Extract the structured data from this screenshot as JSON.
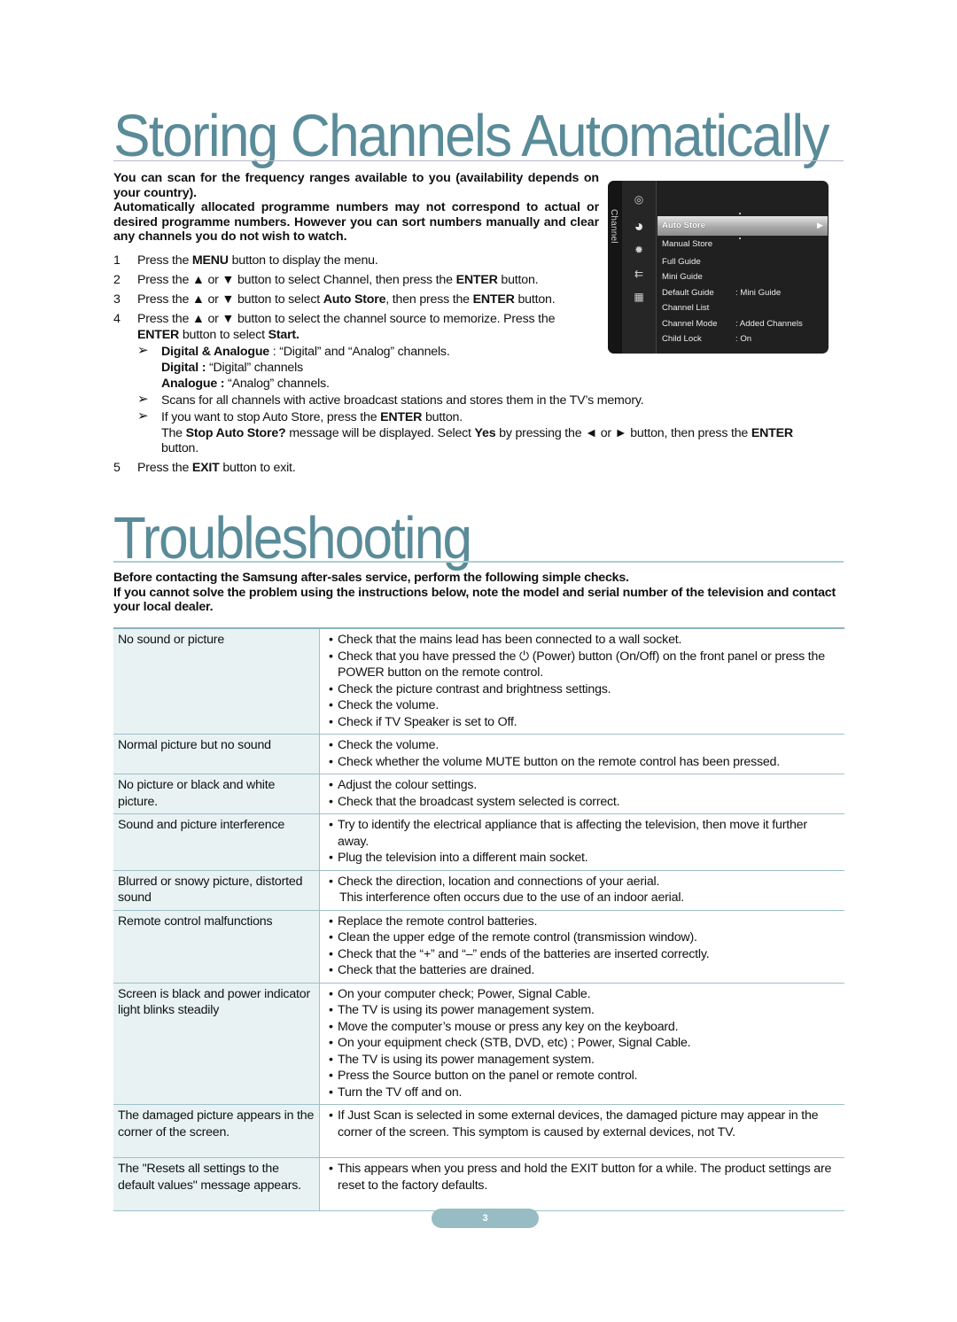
{
  "section1": {
    "title": "Storing Channels Automatically",
    "intro": [
      "You can scan for the frequency ranges available to you (availability depends on your country).",
      "Automatically allocated programme numbers may not correspond to actual or desired programme numbers. However you can sort numbers manually and clear any channels you do not wish to watch."
    ],
    "steps": [
      {
        "num": "1",
        "parts": [
          [
            "Press the ",
            false
          ],
          [
            "MENU",
            true
          ],
          [
            " button to display the menu.",
            false
          ]
        ]
      },
      {
        "num": "2",
        "parts": [
          [
            "Press the ▲ or ▼ button to select Channel, then press the ",
            false
          ],
          [
            "ENTER",
            true
          ],
          [
            " button.",
            false
          ]
        ]
      },
      {
        "num": "3",
        "parts": [
          [
            "Press the ▲ or ▼ button to select ",
            false
          ],
          [
            "Auto Store",
            true
          ],
          [
            ", then press  the ",
            false
          ],
          [
            "ENTER",
            true
          ],
          [
            " button.",
            false
          ]
        ]
      },
      {
        "num": "4",
        "parts": [
          [
            "Press the ▲ or ▼ button to select the channel source to memorize. Press the ",
            false
          ],
          [
            "ENTER",
            true
          ],
          [
            " button to select ",
            false
          ],
          [
            "Start.",
            true
          ]
        ]
      }
    ],
    "notes": [
      {
        "lines": [
          [
            [
              "Digital & Analogue",
              true
            ],
            [
              " : “Digital” and “Analog” channels.",
              false
            ]
          ],
          [
            [
              "Digital :",
              true
            ],
            [
              " “Digital” channels",
              false
            ]
          ],
          [
            [
              "Analogue :",
              true
            ],
            [
              " “Analog” channels.",
              false
            ]
          ]
        ]
      },
      {
        "lines": [
          [
            [
              "Scans for all channels with active broadcast stations and stores them in the TV’s memory.",
              false
            ]
          ]
        ]
      },
      {
        "lines": [
          [
            [
              "If you want to stop Auto Store, press the ",
              false
            ],
            [
              "ENTER",
              true
            ],
            [
              " button.",
              false
            ]
          ]
        ]
      }
    ],
    "stop_message": [
      [
        "The ",
        false
      ],
      [
        "Stop Auto Store?",
        true
      ],
      [
        " message will be displayed. Select ",
        false
      ],
      [
        "Yes",
        true
      ],
      [
        " by pressing the ◄ or ► button, then press the ",
        false
      ],
      [
        "ENTER",
        true
      ],
      [
        " button.",
        false
      ]
    ],
    "step5": {
      "num": "5",
      "parts": [
        [
          "Press the ",
          false
        ],
        [
          "EXIT",
          true
        ],
        [
          " button to exit.",
          false
        ]
      ]
    },
    "note_arrow": "➢"
  },
  "tv_menu": {
    "tab_label": "Channel",
    "icons": [
      "picture-icon",
      "channel-icon",
      "setup-icon",
      "input-icon",
      "application-icon"
    ],
    "items": [
      {
        "label": "Auto Store",
        "value": "",
        "selected": true
      },
      {
        "label": "Manual Store",
        "value": ""
      },
      {
        "label": "Full Guide",
        "value": ""
      },
      {
        "label": "Mini Guide",
        "value": ""
      },
      {
        "label": "Default Guide",
        "value": ": Mini Guide"
      },
      {
        "label": "Channel List",
        "value": ""
      },
      {
        "label": "Channel Mode",
        "value": ": Added Channels"
      },
      {
        "label": "Child Lock",
        "value": ": On"
      }
    ],
    "selected_arrow": "▶"
  },
  "section2": {
    "title": "Troubleshooting",
    "lead": [
      "Before contacting the Samsung after-sales service, perform the following simple checks.",
      "If you cannot solve the problem using the instructions below, note the model and serial number of the television and contact your local dealer."
    ],
    "rows": [
      {
        "problem": "No sound or picture",
        "solutions": [
          "Check that the mains lead has been connected to a wall socket.",
          "Check that you have pressed the ⏻ (Power) button (On/Off) on the front panel or press the POWER button on the remote control.",
          "Check the picture contrast and brightness settings.",
          "Check the volume.",
          "Check if TV Speaker is set to Off."
        ]
      },
      {
        "problem": "Normal picture but no sound",
        "solutions": [
          "Check the volume.",
          "Check whether the volume MUTE button on the remote control has been pressed."
        ]
      },
      {
        "problem": "No picture or black and white picture.",
        "solutions": [
          "Adjust the colour settings.",
          "Check that the broadcast system selected is correct."
        ]
      },
      {
        "problem": "Sound and picture interference",
        "solutions": [
          "Try to identify the electrical appliance that is affecting the television, then move it further away.",
          "Plug the television into a different main socket."
        ]
      },
      {
        "problem": "Blurred or snowy picture, distorted sound",
        "solutions": [
          "Check the direction, location and connections of your aerial."
        ],
        "continuation": "This interference often occurs due to the use of an indoor aerial."
      },
      {
        "problem": "Remote control malfunctions",
        "solutions": [
          "Replace the remote control batteries.",
          "Clean the upper edge of the remote control (transmission window).",
          "Check that the “+” and “–” ends of the batteries are inserted correctly.",
          "Check that the batteries are drained."
        ]
      },
      {
        "problem": "Screen is black and power indicator light blinks steadily",
        "solutions": [
          "On your computer check; Power, Signal Cable.",
          "The TV is using its power management system.",
          "Move the computer’s mouse or press any key on the keyboard.",
          "On your equipment check (STB, DVD, etc) ; Power, Signal Cable.",
          "The TV is using its power management system.",
          "Press the Source button on the panel or remote control.",
          "Turn the TV off and on."
        ]
      },
      {
        "problem": "The damaged picture appears in the corner of the screen.",
        "solutions": [
          "If Just Scan is selected in some external devices, the damaged picture may appear in the corner of the screen. This symptom is caused by external devices, not TV."
        ],
        "tall": true
      },
      {
        "problem": "The \"Resets all settings to the default values\" message appears.",
        "solutions": [
          "This appears when you press and hold the EXIT button for a while. The product settings are reset to the factory defaults."
        ],
        "tall": true
      }
    ]
  },
  "page_number": "3"
}
